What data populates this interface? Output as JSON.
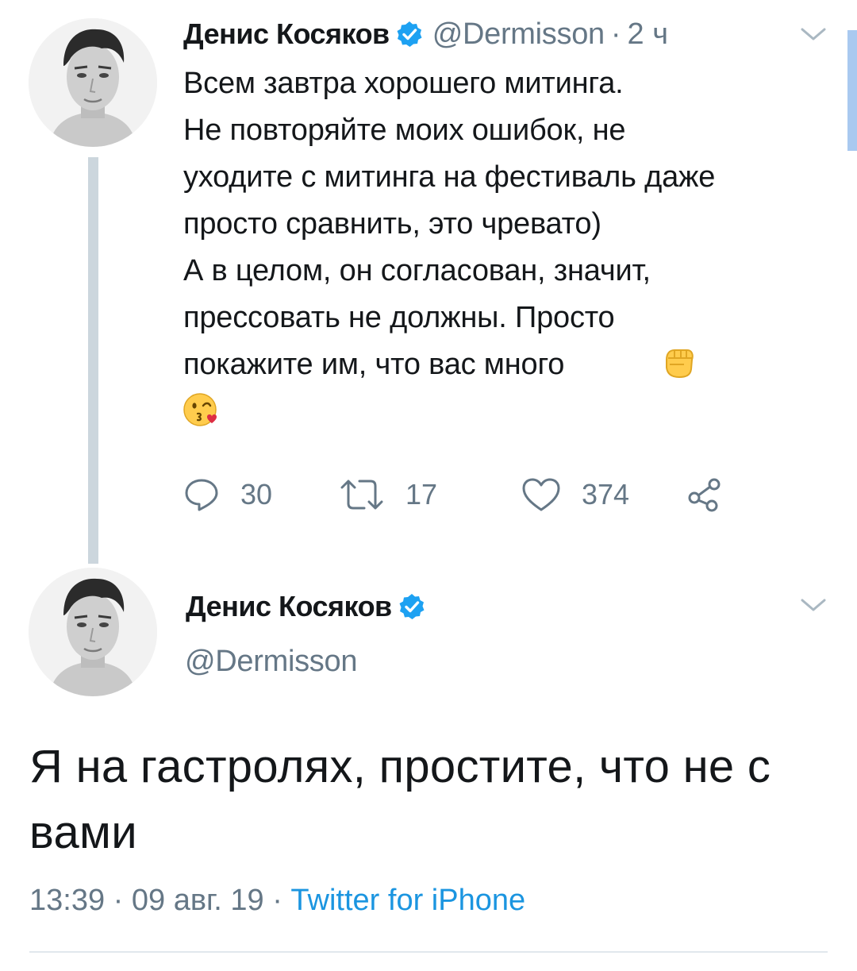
{
  "tweet1": {
    "author_name": "Денис Косяков",
    "handle": "@Dermisson",
    "separator": "·",
    "time": "2 ч",
    "text": "Всем завтра хорошего митинга.\nНе повторяйте моих ошибок, не\nуходите с митинга на фестиваль даже\nпросто сравнить, это чревато)\nА в целом, он согласован, значит,\nпрессовать не должны. Просто\nпокажите им, что вас много",
    "emojis": [
      "raised-fist-emoji",
      "kiss-emoji"
    ],
    "replies": "30",
    "retweets": "17",
    "likes": "374"
  },
  "tweet2": {
    "author_name": "Денис Косяков",
    "handle": "@Dermisson",
    "text": "Я на гастролях, простите, что не с вами",
    "time": "13:39",
    "separator1": "·",
    "date": "09 авг. 19",
    "separator2": "·",
    "source": "Twitter for iPhone"
  },
  "colors": {
    "text": "#14171a",
    "secondary": "#657786",
    "accent": "#1b95e0",
    "verified": "#1da1f2",
    "thread_line": "#ccd6dd"
  }
}
